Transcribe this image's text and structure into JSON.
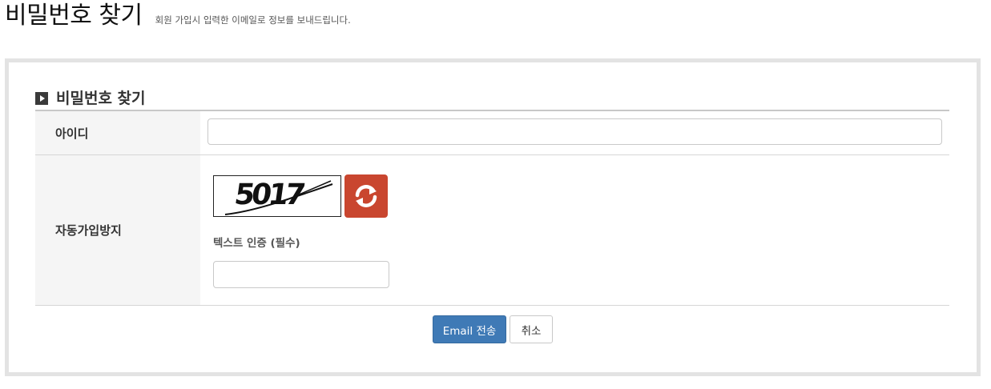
{
  "header": {
    "title": "비밀번호 찾기",
    "subtitle": "회원 가입시 입력한 이메일로 정보를 보내드립니다."
  },
  "form": {
    "section_title": "비밀번호 찾기",
    "section_icon": "play-square-icon",
    "id_label": "아이디",
    "id_value": "",
    "captcha_label": "자동가입방지",
    "captcha_image_text": "5017",
    "captcha_refresh_icon": "refresh-icon",
    "captcha_hint": "텍스트 인증 (필수)",
    "captcha_value": ""
  },
  "actions": {
    "submit_label": "Email 전송",
    "cancel_label": "취소"
  },
  "colors": {
    "primary_button": "#3f7ab6",
    "refresh_button": "#c9462f",
    "frame_border": "#e3e3e3",
    "label_bg": "#f5f5f5"
  }
}
